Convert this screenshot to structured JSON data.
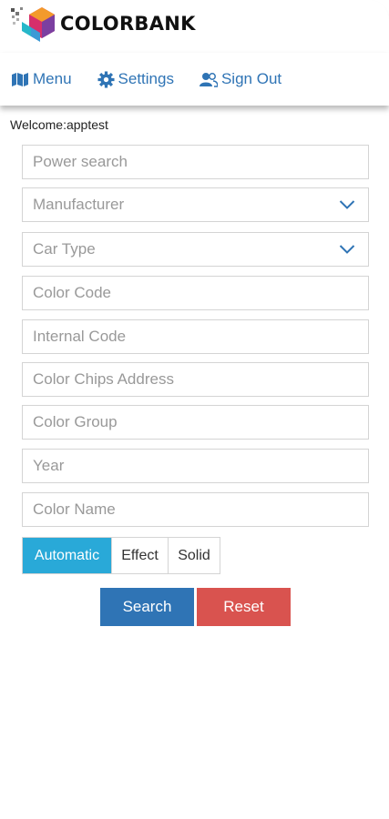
{
  "app": {
    "brand": "COLORBANK"
  },
  "nav": {
    "menu": "Menu",
    "settings": "Settings",
    "signout": "Sign Out"
  },
  "welcome": "Welcome:apptest",
  "form": {
    "power_search": "Power search",
    "manufacturer": "Manufacturer",
    "car_type": "Car Type",
    "color_code": "Color Code",
    "internal_code": "Internal Code",
    "chips_address": "Color Chips Address",
    "color_group": "Color Group",
    "year": "Year",
    "color_name": "Color Name"
  },
  "finish": {
    "automatic": "Automatic",
    "effect": "Effect",
    "solid": "Solid",
    "selected": "Automatic"
  },
  "actions": {
    "search": "Search",
    "reset": "Reset"
  },
  "colors": {
    "primary": "#2f74b5",
    "active_toggle": "#29a9d8",
    "reset": "#d9534f"
  },
  "icons": {
    "menu": "map-icon",
    "settings": "gear-icon",
    "signout": "users-icon",
    "dropdown": "chevron-down-icon"
  }
}
